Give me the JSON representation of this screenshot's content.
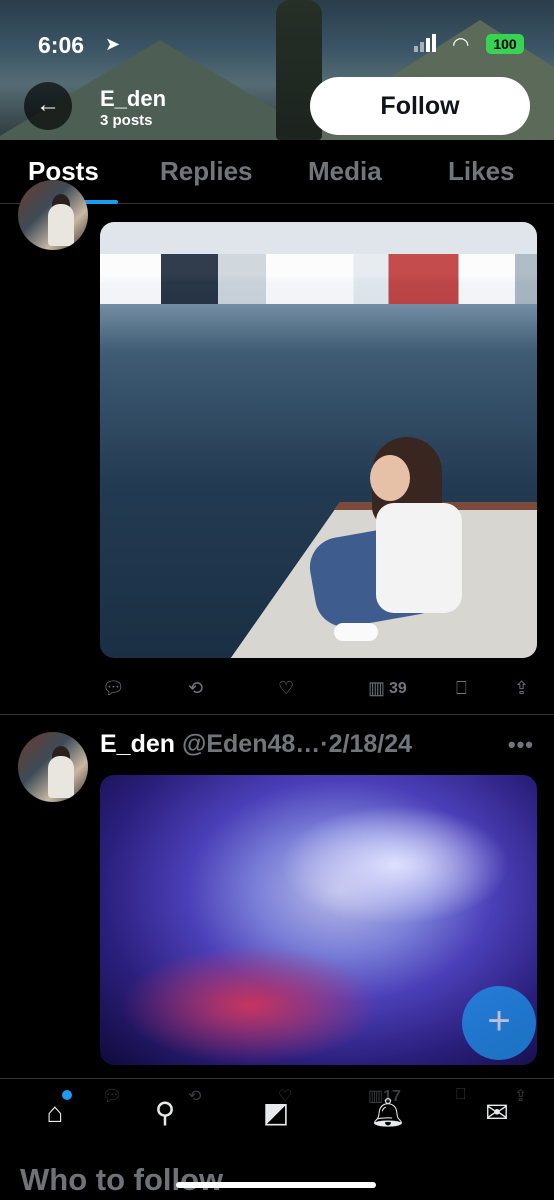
{
  "status_bar": {
    "time": "6:06",
    "battery": "100"
  },
  "header": {
    "name": "E_den",
    "posts_count": "3 posts",
    "follow_label": "Follow"
  },
  "tabs": [
    {
      "label": "Posts"
    },
    {
      "label": "Replies"
    },
    {
      "label": "Media"
    },
    {
      "label": "Likes"
    }
  ],
  "post1": {
    "views": "39"
  },
  "post2": {
    "name": "E_den",
    "handle": "@Eden48…",
    "date": "·2/18/24",
    "views": "17"
  },
  "bottom": {
    "who_to_follow": "Who to follow"
  },
  "icons": [
    "back-arrow-icon",
    "location-arrow-icon",
    "wifi-icon",
    "reply-icon",
    "retweet-icon",
    "like-icon",
    "views-icon",
    "bookmark-icon",
    "share-icon",
    "more-icon",
    "compose-plus-icon",
    "home-icon",
    "search-icon",
    "grok-icon",
    "notifications-icon",
    "messages-icon"
  ],
  "colors": {
    "accent": "#1d9bf0",
    "battery": "#39d353",
    "background": "#000000"
  }
}
